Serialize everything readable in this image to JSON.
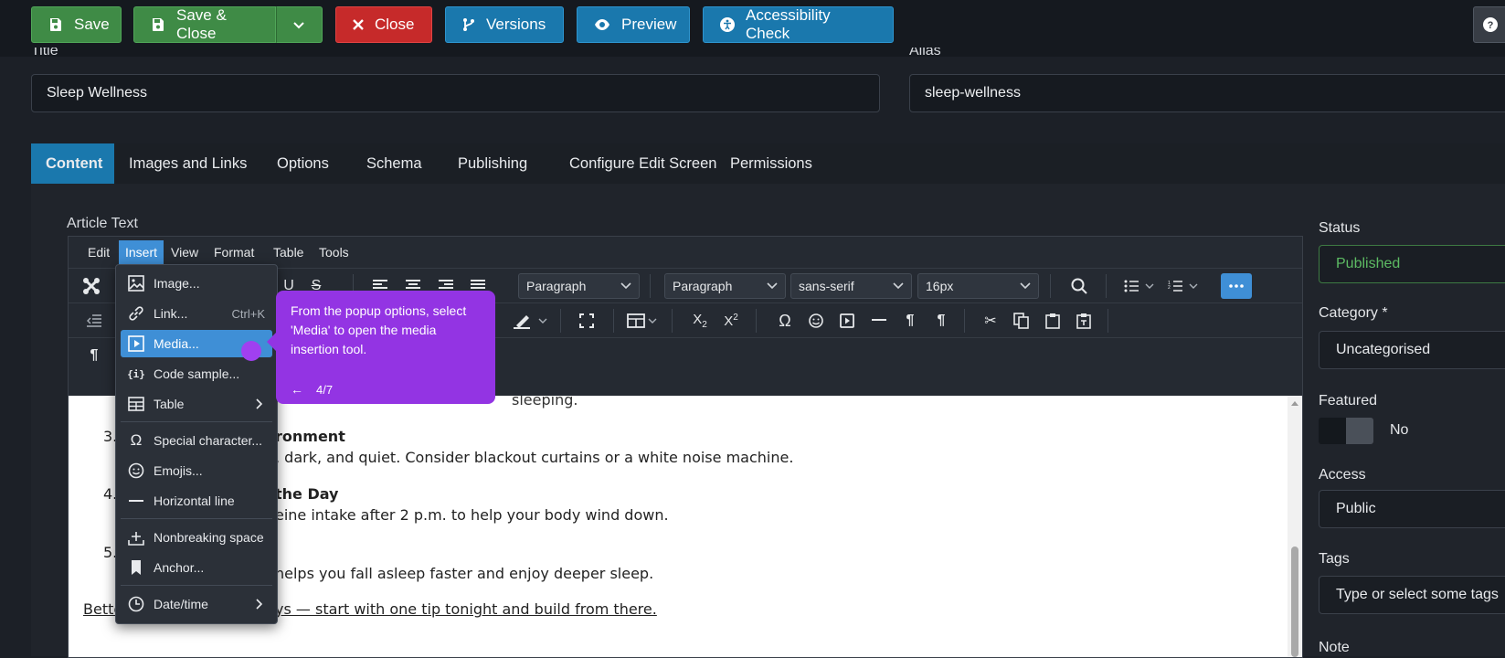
{
  "toolbar": {
    "save": "Save",
    "save_close": "Save & Close",
    "close": "Close",
    "versions": "Versions",
    "preview": "Preview",
    "accessibility": "Accessibility Check"
  },
  "title_label": "Title",
  "title_value": "Sleep Wellness",
  "alias_label": "Alias",
  "alias_value": "sleep-wellness",
  "tabs": [
    "Content",
    "Images and Links",
    "Options",
    "Schema",
    "Publishing",
    "Configure Edit Screen",
    "Permissions"
  ],
  "article_label": "Article Text",
  "editor": {
    "menubar": [
      "Edit",
      "Insert",
      "View",
      "Format",
      "Table",
      "Tools"
    ],
    "block_format": "Paragraph",
    "block_format_2": "Paragraph",
    "font_family": "sans-serif",
    "font_size": "16px"
  },
  "insert_menu": [
    {
      "label": "Image...",
      "icon": "image-icon"
    },
    {
      "label": "Link...",
      "shortcut": "Ctrl+K",
      "icon": "link-icon"
    },
    {
      "label": "Media...",
      "icon": "media-icon"
    },
    {
      "label": "Code sample...",
      "icon": "code-icon"
    },
    {
      "label": "Table",
      "icon": "table-icon"
    },
    {
      "label": "Special character...",
      "icon": "omega-icon"
    },
    {
      "label": "Emojis...",
      "icon": "emoji-icon"
    },
    {
      "label": "Horizontal line",
      "icon": "hr-icon"
    },
    {
      "label": "Nonbreaking space",
      "icon": "nbsp-icon"
    },
    {
      "label": "Anchor...",
      "icon": "bookmark-icon"
    },
    {
      "label": "Date/time",
      "icon": "clock-icon"
    }
  ],
  "tooltip": {
    "text": "From the popup options, select 'Media' to open the media insertion tool.",
    "step": "4/7"
  },
  "content": {
    "line0_partial": "sleeping.",
    "n3": "3.",
    "h3_partial": "ronment",
    "p3_partial": ", dark, and quiet. Consider blackout curtains or a white noise machine.",
    "n4": "4.",
    "h4_partial": "the Day",
    "p4_partial": "eine intake after 2 p.m. to help your body wind down.",
    "n5": "5.",
    "p5_partial": "helps you fall asleep faster and enjoy deeper sleep.",
    "footer_left": "Bette",
    "footer_right": "ys — start with one tip tonight and build from there."
  },
  "sidebar": {
    "status_label": "Status",
    "status_value": "Published",
    "category_label": "Category *",
    "category_value": "Uncategorised",
    "featured_label": "Featured",
    "featured_value": "No",
    "access_label": "Access",
    "access_value": "Public",
    "tags_label": "Tags",
    "tags_placeholder": "Type or select some tags",
    "note_label": "Note"
  }
}
